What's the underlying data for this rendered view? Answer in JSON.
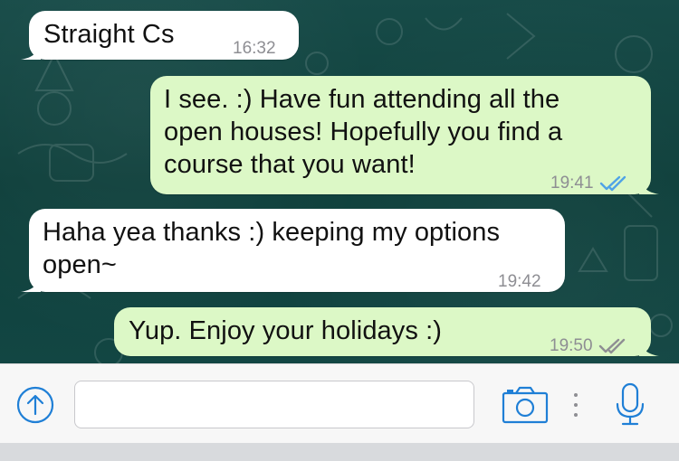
{
  "messages": [
    {
      "direction": "in",
      "text": "Straight Cs",
      "time": "16:32",
      "status": ""
    },
    {
      "direction": "out",
      "text": "I see. :) Have fun attending all the\nopen houses! Hopefully you find a\ncourse that you want!",
      "time": "19:41",
      "status": "read"
    },
    {
      "direction": "in",
      "text": "Haha yea thanks :) keeping my options\nopen~",
      "time": "19:42",
      "status": ""
    },
    {
      "direction": "out",
      "text": "Yup. Enjoy your holidays :)",
      "time": "19:50",
      "status": "delivered"
    }
  ],
  "input_bar": {
    "placeholder": "",
    "value": "",
    "icons": [
      "upload-icon",
      "camera-icon",
      "more-icon",
      "microphone-icon"
    ]
  },
  "colors": {
    "incoming_bubble": "#ffffff",
    "outgoing_bubble": "#dcf8c6",
    "read_tick": "#4fa3e6",
    "delivered_tick": "#8e8e93",
    "accent": "#1f7fd6"
  }
}
